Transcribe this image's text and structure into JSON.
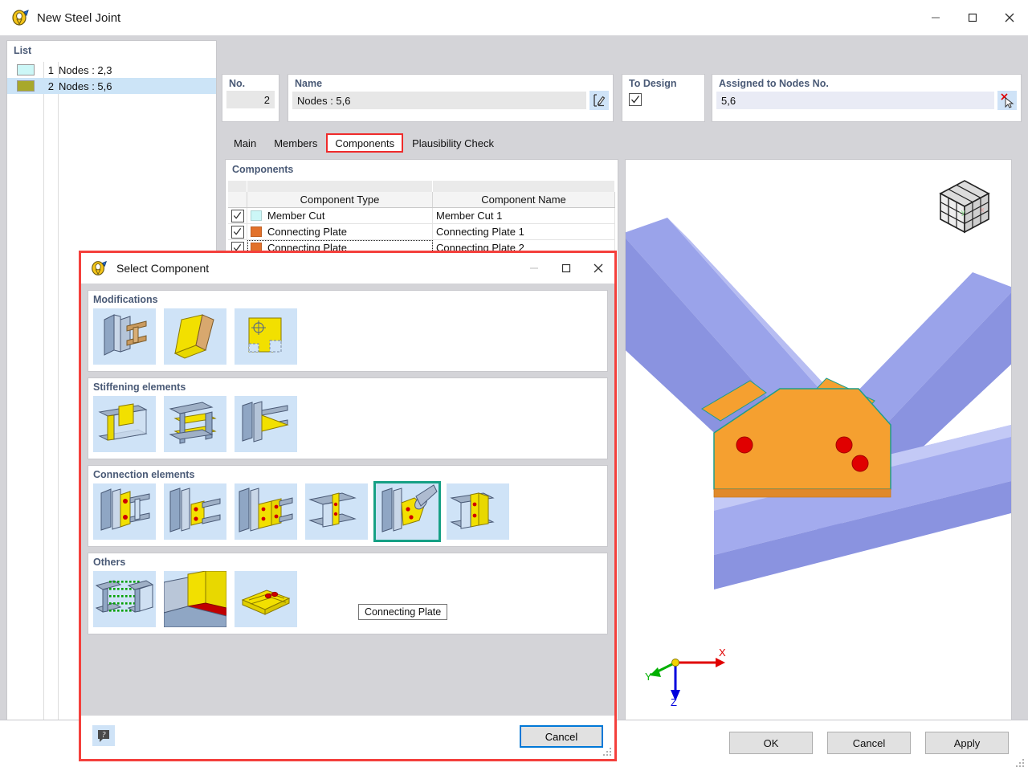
{
  "window": {
    "title": "New Steel Joint",
    "app_icon": "steel-joint-icon",
    "minimize": "–",
    "maximize": "□",
    "close": "✕"
  },
  "list_panel": {
    "caption": "List",
    "rows": [
      {
        "num": "1",
        "label": "Nodes : 2,3",
        "color": "#ccf7f7",
        "selected": false
      },
      {
        "num": "2",
        "label": "Nodes : 5,6",
        "color": "#a8a82b",
        "selected": true
      }
    ]
  },
  "fields": {
    "no_label": "No.",
    "no_value": "2",
    "name_label": "Name",
    "name_value": "Nodes : 5,6",
    "name_edit_icon": "edit-pencil-icon",
    "to_design_label": "To Design",
    "to_design_checked": true,
    "assigned_label": "Assigned to Nodes No.",
    "assigned_value": "5,6",
    "assigned_pick_icon": "pick-deselect-icon"
  },
  "tabs": [
    {
      "label": "Main",
      "active": false,
      "highlight": false
    },
    {
      "label": "Members",
      "active": false,
      "highlight": false
    },
    {
      "label": "Components",
      "active": true,
      "highlight": true
    },
    {
      "label": "Plausibility Check",
      "active": false,
      "highlight": false
    }
  ],
  "components_panel": {
    "caption": "Components",
    "columns": [
      "",
      "Component Type",
      "Component Name"
    ],
    "rows": [
      {
        "checked": true,
        "color": "#ccf7f7",
        "type": "Member Cut",
        "name": "Member Cut 1",
        "focused": false
      },
      {
        "checked": true,
        "color": "#e2712a",
        "type": "Connecting Plate",
        "name": "Connecting Plate 1",
        "focused": false
      },
      {
        "checked": true,
        "color": "#e2712a",
        "type": "Connecting Plate",
        "name": "Connecting Plate 2",
        "focused": true
      }
    ]
  },
  "viewport": {
    "nav_cube": "navigation-cube-icon",
    "axes": {
      "x": "X",
      "y": "Y",
      "z": "Z"
    },
    "colors": {
      "member": "#8c96e8",
      "plate": "#f5a030",
      "bolt": "#e00000"
    },
    "toolbar": [
      {
        "icon": "rotate-view-icon",
        "framed": true,
        "caret": false
      },
      {
        "icon": "coordinate-system-icon",
        "framed": false,
        "caret": true
      },
      {
        "icon": "measure-view-icon",
        "framed": false,
        "caret": false
      },
      {
        "icon": "view-in-x-icon",
        "framed": false,
        "caret": false
      },
      {
        "icon": "view-in-negative-y-icon",
        "framed": false,
        "caret": false
      },
      {
        "icon": "view-in-z-icon",
        "framed": false,
        "caret": false
      },
      {
        "icon": "view-along-z-icon",
        "framed": false,
        "caret": false
      },
      {
        "icon": "render-mode-icon",
        "framed": false,
        "caret": true
      },
      {
        "icon": "box-view-icon",
        "framed": false,
        "caret": true
      },
      {
        "icon": "print-icon",
        "framed": false,
        "caret": true
      },
      {
        "icon": "zoom-reset-icon",
        "framed": false,
        "caret": false
      },
      {
        "icon": "panel-toggle-icon",
        "framed": false,
        "caret": false
      }
    ]
  },
  "bottom_toolbar": [
    {
      "icon": "new-window-icon"
    },
    {
      "icon": "copy-window-icon"
    },
    {
      "icon": "table-icon"
    },
    {
      "icon": "help-icon"
    },
    {
      "icon": "units-icon"
    },
    {
      "icon": "color-icon"
    }
  ],
  "footer": {
    "buttons": [
      {
        "label": "OK",
        "name": "ok-button"
      },
      {
        "label": "Cancel",
        "name": "cancel-button"
      },
      {
        "label": "Apply",
        "name": "apply-button"
      }
    ]
  },
  "dialog": {
    "title": "Select Component",
    "app_icon": "steel-joint-icon",
    "minimize": "–",
    "maximize": "□",
    "close": "✕",
    "groups": [
      {
        "title": "Modifications",
        "items": [
          {
            "icon": "member-cut-icon",
            "selected": false
          },
          {
            "icon": "bend-plate-icon",
            "selected": false
          },
          {
            "icon": "plate-opening-icon",
            "selected": false
          }
        ]
      },
      {
        "title": "Stiffening elements",
        "items": [
          {
            "icon": "web-stiffener-icon",
            "selected": false
          },
          {
            "icon": "flange-stiffener-icon",
            "selected": false
          },
          {
            "icon": "haunch-stiffener-icon",
            "selected": false
          }
        ]
      },
      {
        "title": "Connection elements",
        "items": [
          {
            "icon": "end-plate-icon",
            "selected": false
          },
          {
            "icon": "fin-plate-icon",
            "selected": false
          },
          {
            "icon": "double-fin-plate-icon",
            "selected": false
          },
          {
            "icon": "splice-plate-icon",
            "selected": false
          },
          {
            "icon": "connecting-plate-icon",
            "selected": true
          },
          {
            "icon": "angle-cleat-icon",
            "selected": false
          }
        ]
      },
      {
        "title": "Others",
        "items": [
          {
            "icon": "contact-surface-icon",
            "selected": false
          },
          {
            "icon": "weld-seam-icon",
            "selected": false
          },
          {
            "icon": "bolt-grid-icon",
            "selected": false
          }
        ]
      }
    ],
    "tooltip": "Connecting Plate",
    "help_icon": "help-icon",
    "cancel_label": "Cancel"
  }
}
